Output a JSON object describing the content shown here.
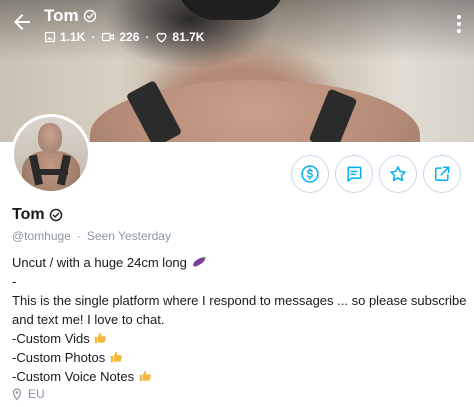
{
  "header": {
    "title": "Tom",
    "stats": {
      "media": "1.1K",
      "videos": "226",
      "likes": "81.7K"
    },
    "separator": "·"
  },
  "profile": {
    "name": "Tom",
    "handle": "@tomhuge",
    "separator": "·",
    "last_seen": "Seen  Yesterday",
    "location": "EU"
  },
  "bio": {
    "line1": "Uncut / with a huge 24cm long",
    "line1_emoji": "eggplant-emoji",
    "line2": "-",
    "line3": "This is the single platform where I respond to messages ... so please subscribe",
    "line4": "and text me! I love to chat.",
    "line5": "-Custom Vids",
    "line6": "-Custom Photos",
    "line7": "-Custom Voice Notes",
    "thumbs_emoji": "thumbs-up-emoji"
  },
  "icons": {
    "back": "arrow-left-icon",
    "verified": "verified-badge-icon",
    "media": "image-icon",
    "video": "video-icon",
    "likes": "heart-icon",
    "more": "more-vertical-icon",
    "tip": "dollar-icon",
    "message": "message-icon",
    "favorite": "star-icon",
    "share": "share-icon",
    "location": "location-pin-icon"
  },
  "colors": {
    "accent": "#00aff0",
    "muted": "#8a96a3",
    "text": "#1a1a1a"
  }
}
